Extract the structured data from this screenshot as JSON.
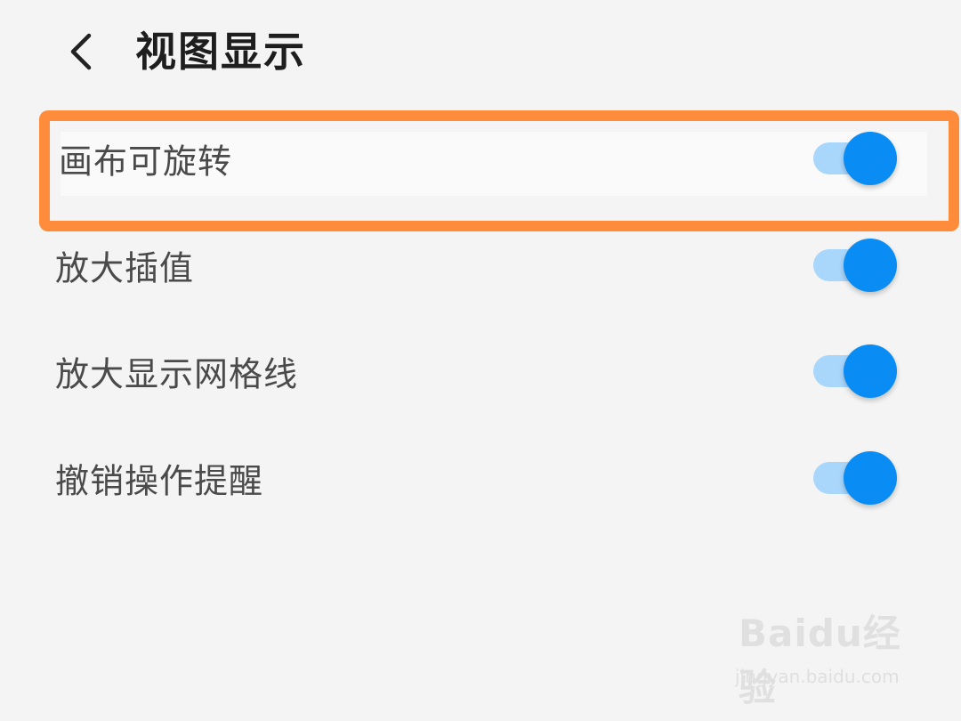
{
  "header": {
    "back_icon": "chevron-left-icon",
    "title": "视图显示"
  },
  "settings": [
    {
      "label": "画布可旋转",
      "enabled": true,
      "highlighted": true
    },
    {
      "label": "放大插值",
      "enabled": true
    },
    {
      "label": "放大显示网格线",
      "enabled": true
    },
    {
      "label": "撤销操作提醒",
      "enabled": true
    }
  ],
  "watermark": {
    "logo": "Baidu经验",
    "url": "jingyan.baidu.com"
  },
  "colors": {
    "background": "#f4f4f4",
    "toggle_thumb": "#0a8cf5",
    "toggle_track": "#a9d6fb",
    "highlight": "#ff8c3a"
  }
}
